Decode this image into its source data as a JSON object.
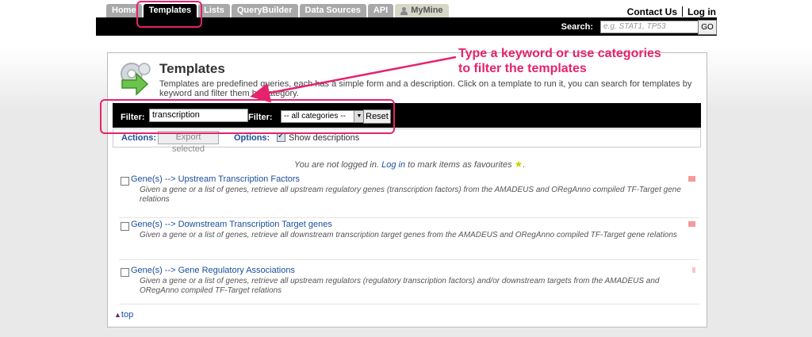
{
  "tabs": [
    {
      "label": "Home",
      "active": false
    },
    {
      "label": "Templates",
      "active": true
    },
    {
      "label": "Lists",
      "active": false
    },
    {
      "label": "QueryBuilder",
      "active": false
    },
    {
      "label": "Data Sources",
      "active": false
    },
    {
      "label": "API",
      "active": false
    },
    {
      "label": "MyMine",
      "active": false
    }
  ],
  "header": {
    "contact_label": "Contact Us",
    "login_label": "Log in",
    "search_label": "Search:",
    "search_placeholder": "e.g. STAT1, TP53",
    "go_label": "GO"
  },
  "page": {
    "title": "Templates",
    "intro": "Templates are predefined queries, each has a simple form and a description. Click on a template to run it, you can search for templates by keyword and filter them by category."
  },
  "filter": {
    "keyword_label": "Filter:",
    "keyword_value": "transcription",
    "category_label": "Filter:",
    "category_value": "-- all categories --",
    "reset_label": "Reset"
  },
  "actions": {
    "actions_label": "Actions:",
    "export_label": "Export selected",
    "options_label": "Options:",
    "show_desc_label": "Show descriptions",
    "show_desc_checked": true
  },
  "notice": {
    "prefix": "You are not logged in.",
    "login": "Log in",
    "suffix": "to mark items as favourites"
  },
  "templates": [
    {
      "title": "Gene(s) --> Upstream Transcription Factors",
      "description": "Given a gene or a list of genes, retrieve all upstream regulatory genes (transcription factors) from the AMADEUS and ORegAnno compiled TF-Target gene relations"
    },
    {
      "title": "Gene(s) --> Downstream Transcription Target genes",
      "description": "Given a gene or a list of genes, retrieve all downstream transcription target genes from the AMADEUS and ORegAnno compiled TF-Target gene relations"
    },
    {
      "title": "Gene(s) --> Gene Regulatory Associations",
      "description": "Given a gene or a list of genes, retrieve all upstream regulators (regulatory transcription factors) and/or downstream targets from the AMADEUS and ORegAnno compiled TF-Target relations"
    }
  ],
  "top_link": "top",
  "annotation": {
    "line1": "Type a keyword or use categories",
    "line2": "to filter the templates"
  },
  "colors": {
    "accent": "#e5236d",
    "link": "#1a4f9c",
    "tab": "#a8a8a8",
    "active_tab": "#000000"
  }
}
